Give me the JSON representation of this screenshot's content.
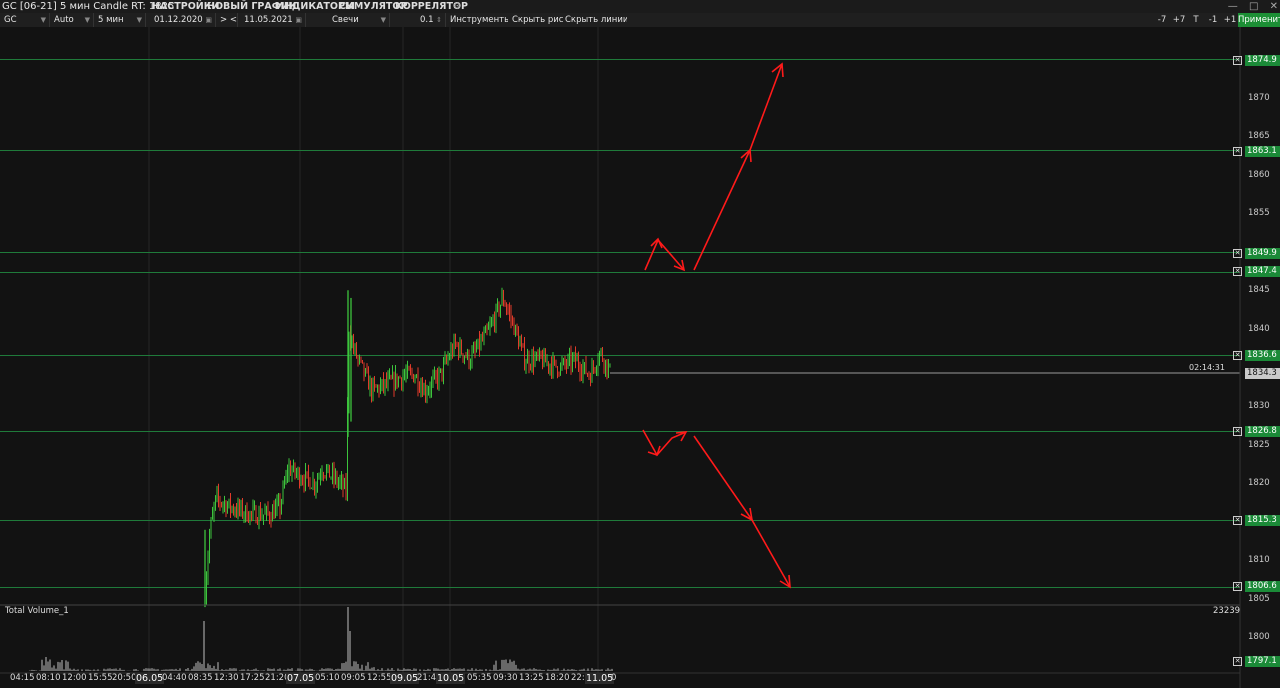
{
  "window": {
    "title": "GC [06-21] 5 мин Candle RT: 1825",
    "menu": [
      {
        "label": "НАСТРОЙКИ",
        "color": "#e0457a"
      },
      {
        "label": "НОВЫЙ ГРАФИК",
        "color": "#ff8a2a"
      },
      {
        "label": "ИНДИКАТОРЫ",
        "color": "#36c23c"
      },
      {
        "label": "СИМУЛЯТОР",
        "color": "#d873e8"
      },
      {
        "label": "КОРРЕЛЯТОР",
        "color": "#3ea0ff"
      }
    ],
    "controls": [
      "—",
      "□",
      "✕"
    ]
  },
  "toolbar": {
    "symbol": "GC",
    "scale": "Auto",
    "timeframe": "5 мин",
    "date_from": "01.12.2020",
    "nav_prev": "> <",
    "date_to": "11.05.2021",
    "chart_type": "Свечи",
    "tick": "0.1",
    "tools": "Инструменты",
    "hide_drawings": "Скрыть рис.",
    "hide_lines": "Скрыть линии",
    "buttons": [
      "-7",
      "+7",
      "T",
      "-1",
      "+1"
    ],
    "apply": "Применить"
  },
  "price_axis": {
    "ticks": [
      "1870",
      "1865",
      "1860",
      "1855",
      "1845",
      "1840",
      "1830",
      "1825",
      "1820",
      "1810",
      "1805",
      "1800"
    ],
    "levels": [
      "1874.9",
      "1863.1",
      "1849.9",
      "1847.4",
      "1836.6",
      "1826.8",
      "1815.3",
      "1806.6",
      "1797.1"
    ],
    "current_price": "1834.3",
    "bar_timer": "02:14:31"
  },
  "volume_panel": {
    "label": "Total Volume_1",
    "max_value": "23239"
  },
  "time_axis": {
    "labels": [
      "04:15",
      "08:10",
      "12:00",
      "15:55",
      "20:50",
      "06.05",
      "04:40",
      "08:35",
      "12:30",
      "17:25",
      "21:20",
      "07.05",
      "05:10",
      "09:05",
      "12:55",
      "09.05",
      "21:4",
      "10.05",
      "05:35",
      "09:30",
      "13:25",
      "18:20",
      "22:",
      "11.05",
      "0"
    ]
  },
  "colors": {
    "level_line": "#1f7a3a",
    "level_badge": "#1b8a38",
    "bull_candle": "#3cc43c",
    "bear_candle": "#e03a2a",
    "arrow": "#ff1a1a",
    "current_badge": "#c9c9c9"
  }
}
